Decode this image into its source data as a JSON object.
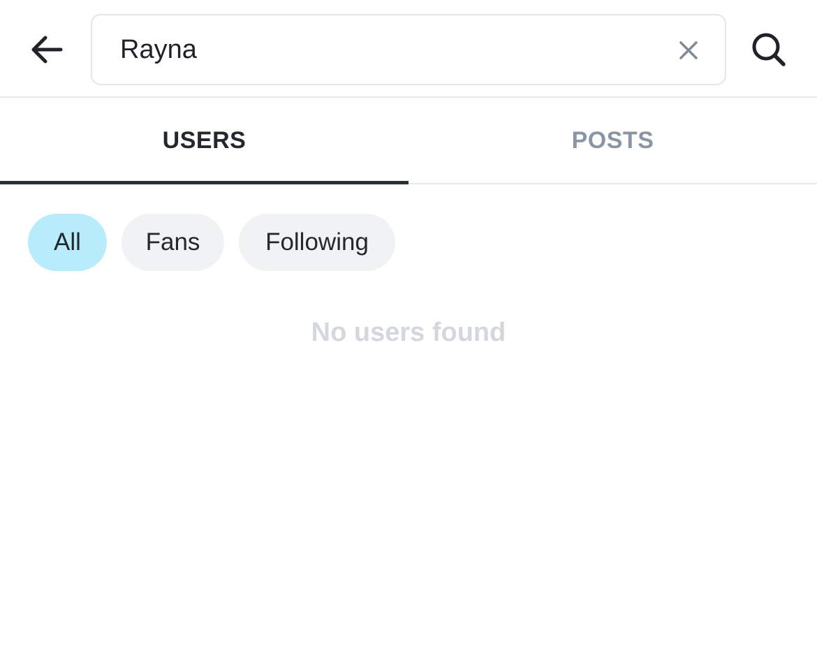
{
  "header": {
    "back_icon": "arrow-left-icon",
    "search": {
      "value": "Rayna",
      "placeholder": "",
      "clear_icon": "close-icon"
    },
    "search_icon": "search-icon"
  },
  "tabs": [
    {
      "label": "USERS",
      "active": true
    },
    {
      "label": "POSTS",
      "active": false
    }
  ],
  "filters": {
    "chips": [
      {
        "label": "All",
        "selected": true
      },
      {
        "label": "Fans",
        "selected": false
      },
      {
        "label": "Following",
        "selected": false
      }
    ]
  },
  "results": {
    "empty_message": "No users found"
  },
  "colors": {
    "active_chip": "#b9ecfb",
    "chip_bg": "#f1f2f4",
    "active_tab": "#23272e",
    "inactive_tab": "#8a96a3",
    "empty_text": "#d3d8de"
  }
}
